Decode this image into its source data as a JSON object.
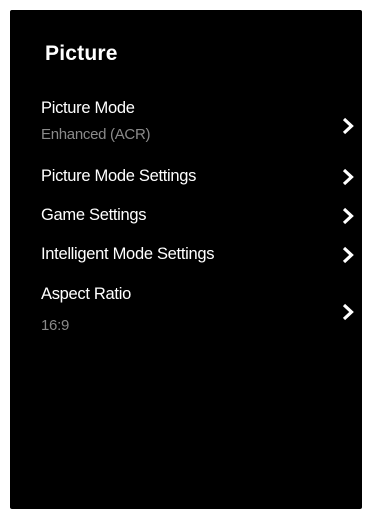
{
  "panel": {
    "title": "Picture"
  },
  "menu": {
    "items": [
      {
        "label": "Picture Mode",
        "value": "Enhanced (ACR)",
        "icon": "chevron-right-icon"
      },
      {
        "label": "Picture Mode Settings",
        "icon": "chevron-right-icon"
      },
      {
        "label": "Game Settings",
        "icon": "chevron-right-icon"
      },
      {
        "label": "Intelligent Mode Settings",
        "icon": "chevron-right-icon"
      },
      {
        "label": "Aspect Ratio",
        "value": "16:9",
        "icon": "chevron-right-icon"
      }
    ]
  },
  "colors": {
    "background": "#000000",
    "text": "#ffffff",
    "secondary_text": "#8a8a8a"
  }
}
